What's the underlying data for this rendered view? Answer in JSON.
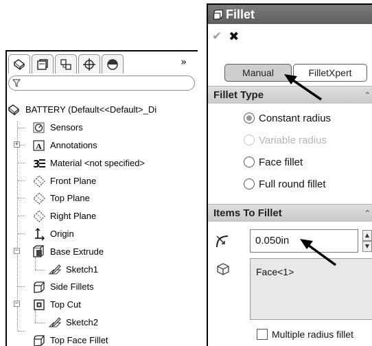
{
  "feature_manager": {
    "tabs": [
      {
        "icon": "feature-manager-tab-icon"
      },
      {
        "icon": "property-manager-tab-icon"
      },
      {
        "icon": "configuration-manager-tab-icon"
      },
      {
        "icon": "dimxpert-manager-tab-icon"
      },
      {
        "icon": "display-manager-tab-icon"
      }
    ],
    "more_label": "»",
    "filter_icon": "filter-icon",
    "tree": [
      {
        "label": "BATTERY  (Default<<Default>_Di",
        "icon": "part-icon"
      },
      {
        "label": "Sensors",
        "icon": "sensors-icon"
      },
      {
        "label": "Annotations",
        "icon": "annotations-icon"
      },
      {
        "label": "Material <not specified>",
        "icon": "material-icon"
      },
      {
        "label": "Front Plane",
        "icon": "plane-icon"
      },
      {
        "label": "Top Plane",
        "icon": "plane-icon"
      },
      {
        "label": "Right Plane",
        "icon": "plane-icon"
      },
      {
        "label": "Origin",
        "icon": "origin-icon"
      },
      {
        "label": "Base Extrude",
        "icon": "extrude-icon"
      },
      {
        "label": "Sketch1",
        "icon": "sketch-icon"
      },
      {
        "label": "Side Fillets",
        "icon": "fillet-icon"
      },
      {
        "label": "Top Cut",
        "icon": "cut-icon"
      },
      {
        "label": "Sketch2",
        "icon": "sketch-icon"
      },
      {
        "label": "Top Face Fillet",
        "icon": "fillet-icon"
      }
    ]
  },
  "property_manager": {
    "title": "Fillet",
    "ok_label": "✔",
    "cancel_label": "✖",
    "modes": {
      "manual": "Manual",
      "filletxpert": "FilletXpert"
    },
    "fillet_type": {
      "header": "Fillet Type",
      "collapse": "⌃",
      "options": [
        {
          "label": "Constant radius",
          "checked": true,
          "enabled": true
        },
        {
          "label": "Variable radius",
          "checked": false,
          "enabled": false
        },
        {
          "label": "Face fillet",
          "checked": false,
          "enabled": true
        },
        {
          "label": "Full round fillet",
          "checked": false,
          "enabled": true
        }
      ]
    },
    "items_to_fillet": {
      "header": "Items To Fillet",
      "collapse": "⌃",
      "radius_value": "0.050in",
      "spin_up": "▲",
      "spin_down": "▼",
      "selection": "Face<1>",
      "multiple_radius_label": "Multiple radius fillet"
    }
  }
}
